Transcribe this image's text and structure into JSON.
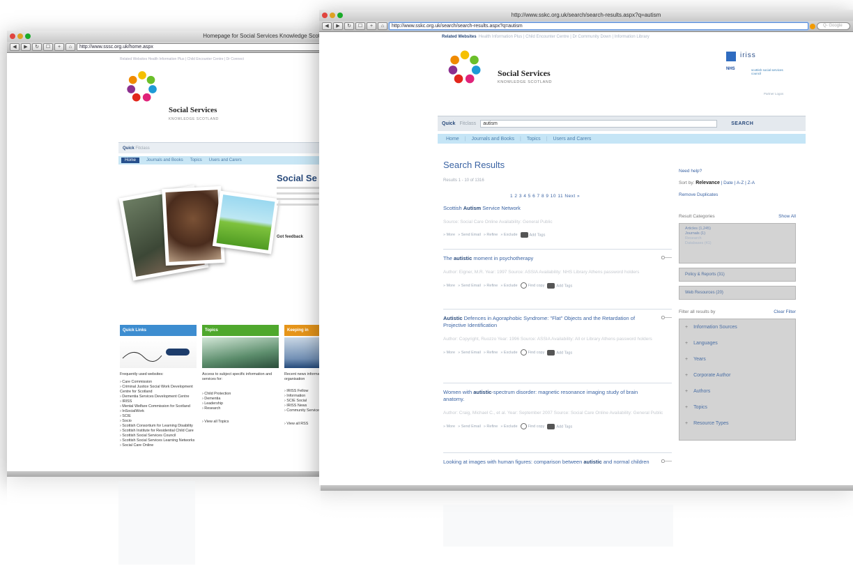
{
  "back_window": {
    "title": "Homepage for Social Services Knowledge Scotland",
    "url": "http://www.sssc.org.uk/home.aspx",
    "related_websites": "Related Websites   Health Information Plus | Child Encounter Centre | Dr Connect",
    "site": {
      "name": "Social Services",
      "subtitle": "KNOWLEDGE SCOTLAND"
    },
    "quick_label": "Quick",
    "quick_sublabel": "Fitclass",
    "nav": [
      "Home",
      "Journals and Books",
      "Topics",
      "Users and Carers"
    ],
    "heading": "Social Se",
    "feedback": "Got feedback",
    "columns": {
      "quick_links": {
        "header": "Quick Links",
        "intro": "Frequently used websites:",
        "items": [
          "Care Commission",
          "Criminal Justice Social Work Development Centre for Scotland",
          "Dementia Services Development Centre",
          "IRISS",
          "Mental Welfare Commission for Scotland",
          "InSocialWork",
          "SCIE",
          "Socio",
          "Scottish Consortium for Learning Disability",
          "Scottish Institute for Residential Child Care",
          "Scottish Social Services Council",
          "Scottish Social Services Learning Networks",
          "Social Care Online"
        ]
      },
      "topics": {
        "header": "Topics",
        "intro": "Access to subject specific information and services for:",
        "items": [
          "Child Protection",
          "Dementia",
          "Leadership",
          "Research"
        ],
        "view_all": "View all Topics"
      },
      "third": {
        "header": "Keeping in",
        "intro": "Recent news information organisation",
        "items": [
          "IRISS Fellow",
          "Information",
          "SCIE Social",
          "IRISS News",
          "Community Services Te"
        ],
        "view_all": "View all RSS"
      }
    }
  },
  "front_window": {
    "title": "http://www.sskc.org.uk/search/search-results.aspx?q=autism",
    "url": "http://www.sskc.org.uk/search/search-results.aspx?q=autism",
    "search_placeholder": "Q- Google",
    "related_label": "Related Websites",
    "related_links": "Health Information Plus | Child Encounter Centre | Dr Community Down | Information Library",
    "site": {
      "name": "Social Services",
      "subtitle": "KNOWLEDGE SCOTLAND"
    },
    "partners": {
      "nhs": "NHS",
      "iriss": "iriss",
      "sssc": "scottish social services council",
      "partners_link": "Partner Logos"
    },
    "quick": {
      "label": "Quick",
      "sublabel": "Fitclass",
      "value": "autism",
      "button": "SEARCH"
    },
    "nav": [
      "Home",
      "Journals and Books",
      "Topics",
      "Users and Carers"
    ],
    "search_results": {
      "title": "Search Results",
      "count": "Results 1 - 10 of 1316",
      "pager": "1 2 3 4 5 6 7 8 9 10 11 Next »",
      "items": [
        {
          "title_pre": "Scottish ",
          "title_bold": "Autism",
          "title_post": " Service Network",
          "meta_html": "Source: Social Care Online   Availability: General Public",
          "actions": [
            "» More",
            "» Send Email",
            "» Refine",
            "» Exclude"
          ],
          "find_copy": "",
          "add_tags": "Add Tags",
          "key": ""
        },
        {
          "title_pre": "The ",
          "title_bold": "autistic",
          "title_post": " moment in psychotherapy",
          "meta_html": "Author: Eigner, M.R.   Year: 1997   Source: ASSIA   Availability: NHS Library Athens password holders",
          "actions": [
            "» More",
            "» Send Email",
            "» Refine",
            "» Exclude"
          ],
          "find_copy": "Find copy",
          "add_tags": "Add Tags",
          "key": "O──"
        },
        {
          "title_pre": "",
          "title_bold": "Autistic",
          "title_post": " Defences in Agoraphobic Syndrome: \"Flat\" Objects and the Retardation of Projective Identification",
          "meta_html": "Author: Copyright, Ruozzo   Year: 1996   Source: ASSIA   Availability: All or Library Athens password holders",
          "actions": [
            "» More",
            "» Send Email",
            "» Refine",
            "» Exclude"
          ],
          "find_copy": "Find copy",
          "add_tags": "Add Tags",
          "key": "O──"
        },
        {
          "title_pre": "Women with ",
          "title_bold": "autistic",
          "title_post": "-spectrum disorder: magnetic resonance imaging study of brain anatomy.",
          "meta_html": "Author: Craig, Michael C., et al.   Year: September 2007   Source: Social Care Online   Availability: General Public",
          "actions": [
            "» More",
            "» Send Email",
            "» Refine",
            "» Exclude"
          ],
          "find_copy": "Find copy",
          "add_tags": "Add Tags",
          "key": ""
        },
        {
          "title_pre": "Looking at images with human figures: comparison between ",
          "title_bold": "autistic",
          "title_post": " and normal children",
          "meta_html": "",
          "actions": [],
          "find_copy": "",
          "add_tags": "",
          "key": "O──"
        }
      ]
    },
    "sidebar": {
      "need_help": "Need help?",
      "sort_label": "Sort by:",
      "sort_active": "Relevance",
      "sort_options": "| Date | A-Z | Z-A",
      "remove_duplicates": "Remove Duplicates",
      "categories_label": "Result Categories",
      "show_all": "Show All",
      "category_box": [
        "Articles (1,245)",
        "Journals (1)",
        "Research",
        "Databases (41)"
      ],
      "policy": "Policy & Reports (31)",
      "web_resources": "Web Resources (20)",
      "filter_label": "Filter all results by",
      "clear_filter": "Clear Filter",
      "filters": [
        "Information Sources",
        "Languages",
        "Years",
        "Corporate Author",
        "Authors",
        "Topics",
        "Resource Types"
      ]
    }
  },
  "colors": {
    "accent_blue": "#3a63a3",
    "nav_blue": "#c5e5f6",
    "sidebar_grey": "#d3d3d3"
  }
}
